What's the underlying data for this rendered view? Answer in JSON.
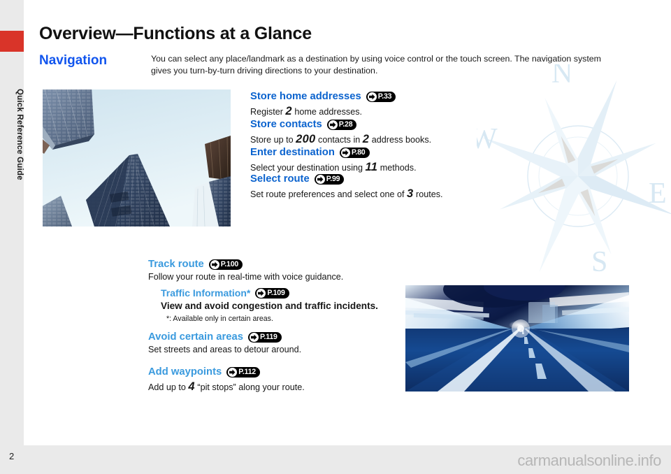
{
  "document": {
    "title": "Overview—Functions at a Glance",
    "sidebar_label": "Quick Reference Guide",
    "page_number": "2",
    "watermark": "carmanualsonline.info"
  },
  "section": {
    "title": "Navigation",
    "intro": "You can select any place/landmark as a destination by using voice control or the touch screen. The navigation system gives you turn-by-turn driving directions to your destination."
  },
  "colors": {
    "accent_red": "#d93429",
    "heading_blue": "#1155ee",
    "feature_blue": "#0b63ce",
    "feature_blue_light": "#3a9ade",
    "badge_black": "#000000",
    "page_gray": "#eaeaea",
    "watermark_gray": "#b6b6b6"
  },
  "features": [
    {
      "title": "Store home addresses",
      "ref": "P.33",
      "desc_pre": "Register ",
      "desc_num": "2",
      "desc_post": " home addresses."
    },
    {
      "title": "Store contacts",
      "ref": "P.28",
      "desc_pre": "Store up to ",
      "desc_num": "200",
      "desc_mid": " contacts in ",
      "desc_num2": "2",
      "desc_post": " address books."
    },
    {
      "title": "Enter destination",
      "ref": "P.80",
      "desc_pre": "Select your destination using ",
      "desc_num": "11",
      "desc_post": " methods."
    },
    {
      "title": "Select route",
      "ref": "P.99",
      "desc_pre": "Set route preferences and select one of ",
      "desc_num": "3",
      "desc_post": " routes."
    }
  ],
  "route_features": {
    "track": {
      "title": "Track route",
      "ref": "P.100",
      "desc": "Follow your route in real-time with voice guidance."
    },
    "traffic": {
      "title": "Traffic Information*",
      "ref": "P.109",
      "desc": "View and avoid congestion and traffic incidents.",
      "footnote": "*: Available only in certain areas."
    },
    "avoid": {
      "title": "Avoid certain areas",
      "ref": "P.119",
      "desc": "Set streets and areas to detour around."
    },
    "waypoints": {
      "title": "Add waypoints",
      "ref": "P.112",
      "desc_pre": "Add up to ",
      "desc_num": "4",
      "desc_post": " “pit stops” along your route."
    }
  },
  "images": {
    "buildings": "skyscrapers-looking-up-photo",
    "tunnel": "motion-blur-highway-tunnel-photo"
  },
  "compass": {
    "north": "N",
    "east": "E",
    "south": "S",
    "west": "W"
  }
}
